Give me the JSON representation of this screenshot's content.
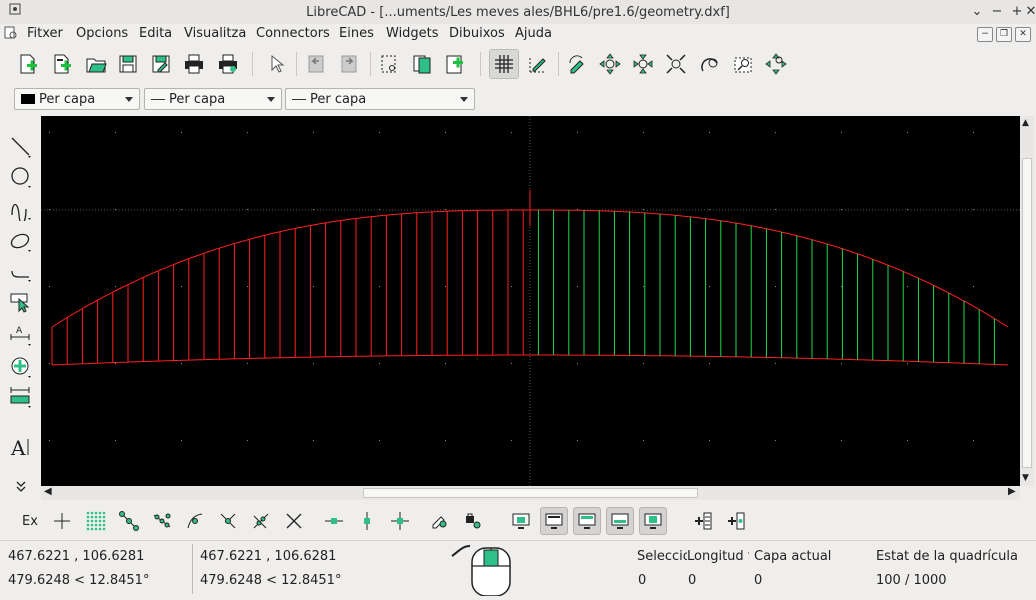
{
  "window": {
    "title": "LibreCAD - [...uments/Les meves ales/BHL6/pre1.6/geometry.dxf]",
    "controls": [
      "⌄",
      "−",
      "+",
      "✕"
    ]
  },
  "menubar": {
    "items": [
      "Fitxer",
      "Opcions",
      "Edita",
      "Visualitza",
      "Connectors",
      "Eines",
      "Widgets",
      "Dibuixos",
      "Ajuda"
    ],
    "mdi_controls": [
      "−",
      "❐",
      "✕"
    ]
  },
  "toolbar": {
    "icons": [
      "new-icon",
      "new-template-icon",
      "open-icon",
      "save-icon",
      "save-as-icon",
      "print-icon",
      "print-preview-icon",
      "select-pointer-icon",
      "undo-icon",
      "redo-icon",
      "cut-icon",
      "copy-icon",
      "paste-icon",
      "grid-icon",
      "draft-icon",
      "redraw-icon",
      "zoom-in-icon",
      "zoom-out-icon",
      "zoom-auto-icon",
      "zoom-previous-icon",
      "zoom-window-icon",
      "zoom-pan-icon"
    ],
    "grid_active": true
  },
  "pen_toolbar": {
    "color": "Per capa",
    "width": "Per capa",
    "linetype": "Per capa"
  },
  "left_toolbar": {
    "tools": [
      "line-icon",
      "circle-icon",
      "spline-icon",
      "ellipse-icon",
      "polyline-icon",
      "select-icon",
      "dimension-icon",
      "modify-icon",
      "measure-icon",
      "text-icon",
      "more-icon"
    ]
  },
  "snap_toolbar": {
    "label": "Ex",
    "tools": [
      "snap-free-icon",
      "snap-grid-icon",
      "snap-endpoint-icon",
      "snap-on-entity-icon",
      "snap-center-icon",
      "snap-middle-icon",
      "snap-distance-icon",
      "snap-intersection-icon",
      "restrict-horizontal-icon",
      "restrict-vertical-icon",
      "restrict-orthogonal-icon",
      "relative-zero-icon",
      "lock-relative-zero-icon",
      "view-1-icon",
      "view-2-icon",
      "view-3-icon",
      "view-4-icon",
      "view-5-icon",
      "add-block-icon",
      "add-layer-icon"
    ]
  },
  "status": {
    "coord_abs": "467.6221 , 106.6281",
    "coord_polar": "479.6248 < 12.8451°",
    "coord_rel": "467.6221 , 106.6281",
    "coord_rel_polar": "479.6248 < 12.8451°",
    "selection_label": "Seleccio",
    "selection_value": "0",
    "length_label": "Longitud t",
    "length_value": "0",
    "layer_label": "Capa actual",
    "layer_value": "0",
    "grid_label": "Estat de la quadrícula",
    "grid_value": "100 / 1000"
  },
  "colors": {
    "canvas": "#000000",
    "left_wing": "#ff2020",
    "right_ribs": "#22d84a",
    "grid_dot": "#8a8a8a",
    "accent": "#2fc08a"
  }
}
